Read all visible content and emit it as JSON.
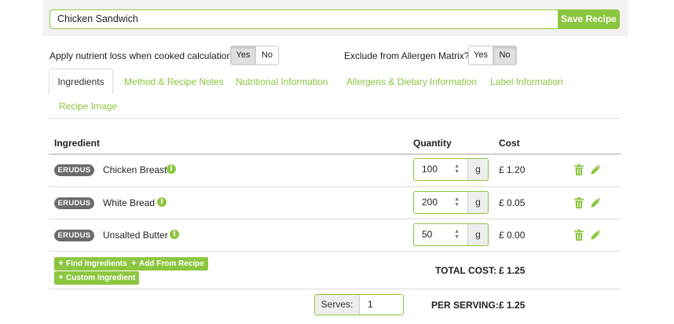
{
  "recipe": {
    "name": "Chicken Sandwich",
    "save_label": "Save Recipe"
  },
  "options": {
    "nutrient_loss": {
      "label": "Apply nutrient loss when cooked calculations :",
      "yes": "Yes",
      "no": "No",
      "selected": "Yes"
    },
    "allergen_matrix": {
      "label": "Exclude from Allergen Matrix? :",
      "yes": "Yes",
      "no": "No",
      "selected": "No"
    }
  },
  "tabs": [
    {
      "label": "Ingredients",
      "active": true
    },
    {
      "label": "Method & Recipe Notes",
      "active": false
    },
    {
      "label": "Nutritional Information",
      "active": false
    },
    {
      "label": "Allergens & Dietary Information",
      "active": false
    },
    {
      "label": "Label Information",
      "active": false
    },
    {
      "label": "Recipe Image",
      "active": false
    }
  ],
  "table": {
    "headers": {
      "ingredient": "Ingredient",
      "quantity": "Quantity",
      "cost": "Cost"
    },
    "rows": [
      {
        "badge": "ERUDUS",
        "name": "Chicken Breast",
        "quantity": "100",
        "unit": "g",
        "cost": "£ 1.20"
      },
      {
        "badge": "ERUDUS",
        "name": "White Bread",
        "quantity": "200",
        "unit": "g",
        "cost": "£ 0.05"
      },
      {
        "badge": "ERUDUS",
        "name": "Unsalted Butter",
        "quantity": "50",
        "unit": "g",
        "cost": "£ 0.00"
      }
    ]
  },
  "actions": {
    "find_ingredients": "Find Ingredients",
    "add_from_recipe": "Add From Recipe",
    "custom_ingredient": "Custom Ingredient"
  },
  "totals": {
    "total_cost_label": "TOTAL COST:",
    "total_cost_value": "£ 1.25",
    "serves_label": "Serves:",
    "serves_value": "1",
    "per_serving_label": "PER SERVING:",
    "per_serving_value": "£ 1.25"
  },
  "icons": {
    "info": "info-icon",
    "delete": "trash-icon",
    "edit": "pencil-icon",
    "spinner": "spinner-icon",
    "add": "plus-icon"
  },
  "colors": {
    "accent": "#8cc63f",
    "badge": "#6b6b6b",
    "band": "#f2f2f2"
  }
}
